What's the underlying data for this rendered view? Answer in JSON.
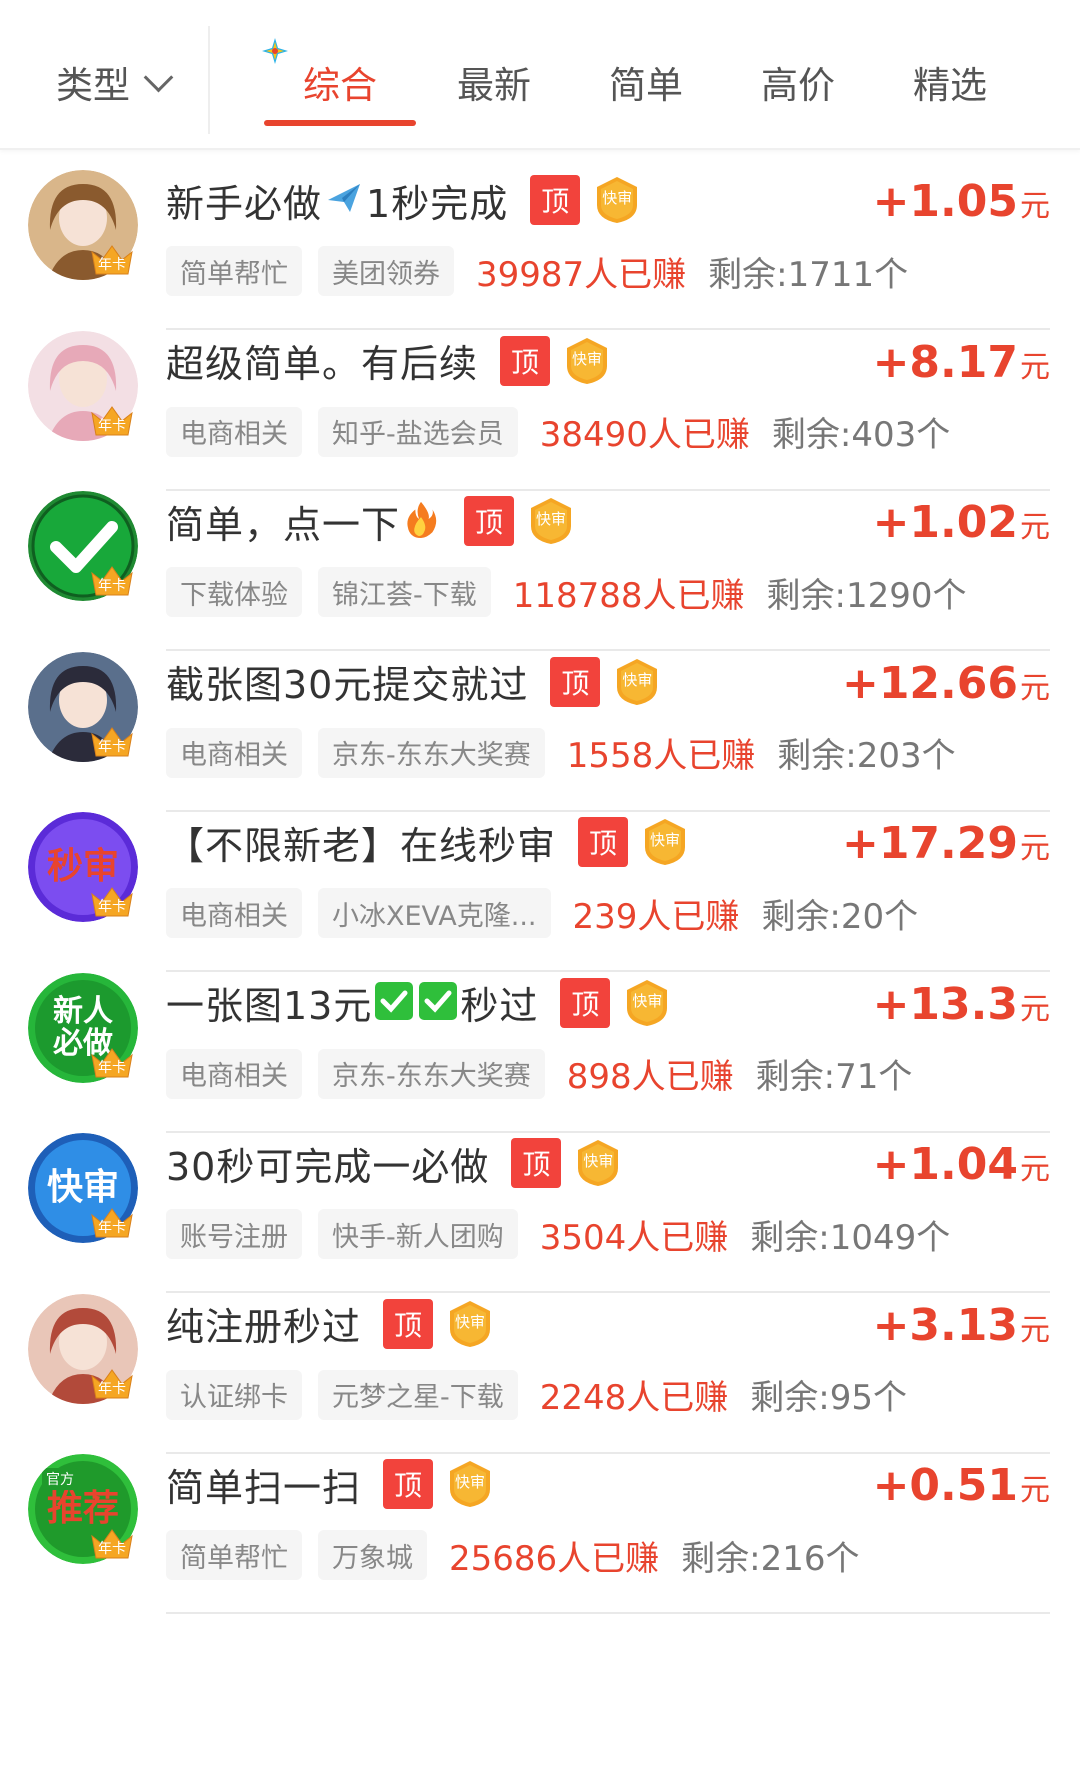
{
  "filter": {
    "type_label": "类型",
    "tabs": [
      {
        "label": "综合",
        "active": true
      },
      {
        "label": "最新",
        "active": false
      },
      {
        "label": "简单",
        "active": false
      },
      {
        "label": "高价",
        "active": false
      },
      {
        "label": "精选",
        "active": false
      }
    ]
  },
  "badges": {
    "top": "顶",
    "fast": "快审",
    "avatar_corner": "年卡"
  },
  "colors": {
    "accent": "#e8442e",
    "top_badge": "#f2433c",
    "fast_badge": "#f5a623"
  },
  "tasks": [
    {
      "title_parts": [
        "新手必做",
        "1秒完成"
      ],
      "emoji": "airplane",
      "reward": "+1.05",
      "unit": "元",
      "tags": [
        "简单帮忙",
        "美团领券"
      ],
      "earned": "39987人已赚",
      "remaining": "剩余:1711个",
      "avatar": "anime-girl-gold"
    },
    {
      "title_parts": [
        "超级简单。有后续"
      ],
      "emoji": "",
      "reward": "+8.17",
      "unit": "元",
      "tags": [
        "电商相关",
        "知乎-盐选会员"
      ],
      "earned": "38490人已赚",
      "remaining": "剩余:403个",
      "avatar": "anime-girl-pink"
    },
    {
      "title_parts": [
        "简单，点一下"
      ],
      "emoji": "fire",
      "reward": "+1.02",
      "unit": "元",
      "tags": [
        "下载体验",
        "锦江荟-下载"
      ],
      "earned": "118788人已赚",
      "remaining": "剩余:1290个",
      "avatar": "green-check"
    },
    {
      "title_parts": [
        "截张图30元提交就过"
      ],
      "emoji": "",
      "reward": "+12.66",
      "unit": "元",
      "tags": [
        "电商相关",
        "京东-东东大奖赛"
      ],
      "earned": "1558人已赚",
      "remaining": "剩余:203个",
      "avatar": "anime-girl-dark"
    },
    {
      "title_parts": [
        "【不限新老】在线秒审"
      ],
      "emoji": "",
      "reward": "+17.29",
      "unit": "元",
      "tags": [
        "电商相关",
        "小冰XEVA克隆..."
      ],
      "earned": "239人已赚",
      "remaining": "剩余:20个",
      "avatar": "purple-miaoshen",
      "avatar_text": "秒审"
    },
    {
      "title_parts": [
        "一张图13元",
        "秒过"
      ],
      "emoji": "check-boxes",
      "reward": "+13.3",
      "unit": "元",
      "tags": [
        "电商相关",
        "京东-东东大奖赛"
      ],
      "earned": "898人已赚",
      "remaining": "剩余:71个",
      "avatar": "green-xinren",
      "avatar_text": "新人必做"
    },
    {
      "title_parts": [
        "30秒可完成一必做"
      ],
      "emoji": "",
      "reward": "+1.04",
      "unit": "元",
      "tags": [
        "账号注册",
        "快手-新人团购"
      ],
      "earned": "3504人已赚",
      "remaining": "剩余:1049个",
      "avatar": "blue-kuaishen",
      "avatar_text": "快审"
    },
    {
      "title_parts": [
        "纯注册秒过"
      ],
      "emoji": "",
      "reward": "+3.13",
      "unit": "元",
      "tags": [
        "认证绑卡",
        "元梦之星-下载"
      ],
      "earned": "2248人已赚",
      "remaining": "剩余:95个",
      "avatar": "girl-photo"
    },
    {
      "title_parts": [
        "简单扫一扫"
      ],
      "emoji": "",
      "reward": "+0.51",
      "unit": "元",
      "tags": [
        "简单帮忙",
        "万象城"
      ],
      "earned": "25686人已赚",
      "remaining": "剩余:216个",
      "avatar": "green-tuijian",
      "avatar_text": "推荐",
      "avatar_sub": "官方"
    }
  ]
}
